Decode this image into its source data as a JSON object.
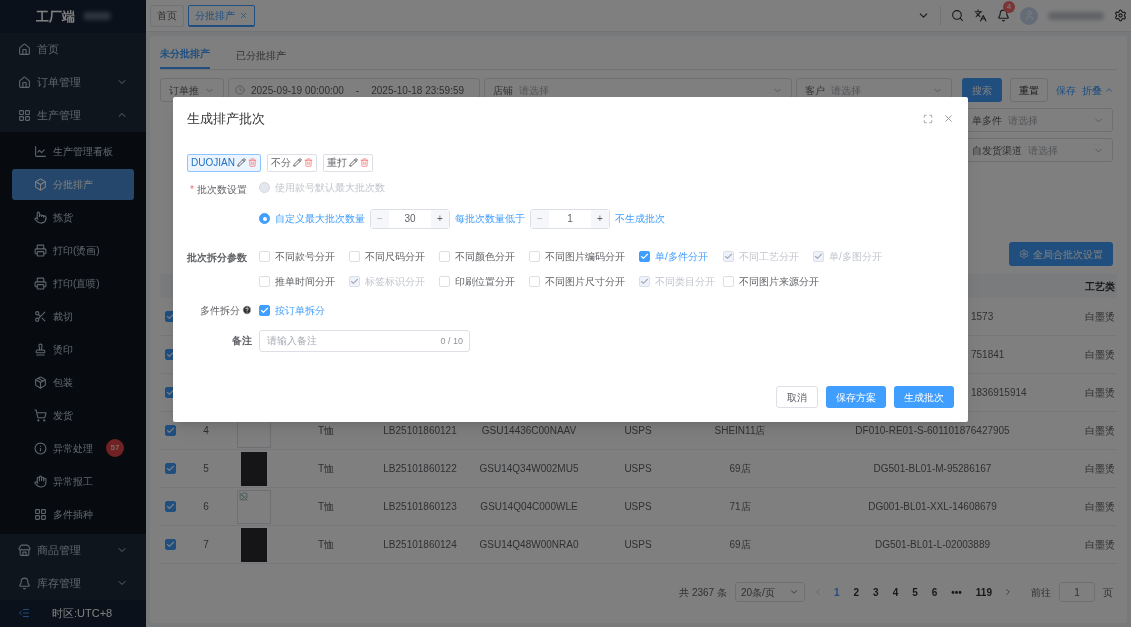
{
  "sidebar": {
    "title": "工厂端",
    "items": [
      {
        "label": "首页",
        "selected": false
      },
      {
        "label": "订单管理",
        "expanded": false,
        "selected": false
      },
      {
        "label": "生产管理",
        "expanded": true,
        "selected": false,
        "children": [
          {
            "label": "生产管理看板",
            "selected": false
          },
          {
            "label": "分批排产",
            "selected": true
          },
          {
            "label": "拣货",
            "selected": false
          },
          {
            "label": "打印(烫画)",
            "selected": false
          },
          {
            "label": "打印(直喷)",
            "selected": false
          },
          {
            "label": "裁切",
            "selected": false
          },
          {
            "label": "烫印",
            "selected": false
          },
          {
            "label": "包装",
            "selected": false
          },
          {
            "label": "发货",
            "selected": false
          },
          {
            "label": "异常处理",
            "selected": false,
            "badge": "57"
          },
          {
            "label": "异常报工",
            "selected": false
          },
          {
            "label": "多件插种",
            "selected": false
          }
        ]
      },
      {
        "label": "商品管理",
        "expanded": false,
        "selected": false
      },
      {
        "label": "库存管理",
        "expanded": false,
        "selected": false
      }
    ],
    "footer": "时区:UTC+8"
  },
  "header": {
    "tabs": [
      {
        "label": "首页",
        "selected": false,
        "closable": false
      },
      {
        "label": "分批排产",
        "selected": true,
        "closable": true
      }
    ],
    "notification_count": "4"
  },
  "page_tabs": [
    {
      "label": "未分批排产",
      "selected": true
    },
    {
      "label": "已分批排产",
      "selected": false
    }
  ],
  "filters": {
    "time_type": "订单推",
    "date_start": "2025-09-19 00:00:00",
    "date_sep": "-",
    "date_end": "2025-10-18 23:59:59",
    "shop": {
      "label": "店铺",
      "placeholder": "请选择"
    },
    "customer": {
      "label": "客户",
      "placeholder": "请选择"
    },
    "search": "搜索",
    "reset": "重置",
    "save": "保存",
    "collapse": "折叠",
    "more": [
      {
        "label": "单多件",
        "placeholder": "请选择"
      },
      {
        "label": "自发货渠道",
        "placeholder": "请选择"
      }
    ]
  },
  "global_merge_button": "全局合批次设置",
  "table": {
    "columns": [
      {
        "label": "工艺类"
      }
    ],
    "rows": [
      {
        "kind": "partial",
        "checked": true,
        "order_no": "1573",
        "craft": "白墨烫"
      },
      {
        "kind": "partial",
        "checked": true,
        "order_no": "751841",
        "craft": "白墨烫"
      },
      {
        "kind": "partial",
        "checked": true,
        "order_no": "1836915914",
        "craft": "白墨烫"
      },
      {
        "kind": "full",
        "checked": true,
        "index": "4",
        "type": "T恤",
        "lb": "LB25101860121",
        "sku": "GSU14436C00NAAV",
        "carrier": "USPS",
        "shop": "SHEIN11店",
        "order_no": "DF010-RE01-S-601101876427905",
        "craft": "白墨烫"
      },
      {
        "kind": "full",
        "checked": true,
        "index": "5",
        "type": "T恤",
        "lb": "LB25101860122",
        "sku": "GSU14Q34W002MU5",
        "carrier": "USPS",
        "shop": "69店",
        "order_no": "DG501-BL01-M-95286167",
        "craft": "白墨烫"
      },
      {
        "kind": "full",
        "checked": true,
        "index": "6",
        "type": "T恤",
        "lb": "LB25101860123",
        "sku": "GSU14Q04C000WLE",
        "carrier": "USPS",
        "shop": "71店",
        "order_no": "DG001-BL01-XXL-14608679",
        "craft": "白墨烫"
      },
      {
        "kind": "full",
        "checked": true,
        "index": "7",
        "type": "T恤",
        "lb": "LB25101860124",
        "sku": "GSU14Q48W00NRA0",
        "carrier": "USPS",
        "shop": "69店",
        "order_no": "DG501-BL01-L-02003889",
        "craft": "白墨烫"
      }
    ]
  },
  "pagination": {
    "total": "共 2367 条",
    "page_size": "20条/页",
    "pages": [
      {
        "label": "1",
        "selected": true
      },
      {
        "label": "2",
        "selected": false
      },
      {
        "label": "3",
        "selected": false
      },
      {
        "label": "4",
        "selected": false
      },
      {
        "label": "5",
        "selected": false
      },
      {
        "label": "6",
        "selected": false
      },
      {
        "label": "•••",
        "selected": false
      },
      {
        "label": "119",
        "selected": false
      }
    ],
    "goto": "前往",
    "goto_value": "1",
    "page_unit": "页"
  },
  "dialog": {
    "title": "生成排产批次",
    "schemes": [
      {
        "label": "DUOJIAN",
        "selected": true
      },
      {
        "label": "不分",
        "selected": false
      },
      {
        "label": "重打",
        "selected": false
      }
    ],
    "batch_label": "批次数设置",
    "required_mark": "*",
    "batch_options": [
      {
        "kind": "default",
        "label": "使用款号默认最大批次数",
        "selected": false,
        "disabled": true
      },
      {
        "kind": "custom",
        "label": "自定义最大批次数量",
        "selected": true,
        "disabled": false,
        "max_stepper": {
          "minus": "−",
          "value": "30",
          "plus": "+"
        },
        "min_label": "每批次数量低于",
        "min_stepper": {
          "minus": "−",
          "value": "1",
          "plus": "+"
        },
        "suffix": "不生成批次"
      }
    ],
    "split_label": "批次拆分参数",
    "split_options": [
      {
        "label": "不同款号分开",
        "checked": false,
        "disabled": false
      },
      {
        "label": "不同尺码分开",
        "checked": false,
        "disabled": false
      },
      {
        "label": "不同颜色分开",
        "checked": false,
        "disabled": false
      },
      {
        "label": "不同图片编码分开",
        "checked": false,
        "disabled": false
      },
      {
        "label": "单/多件分开",
        "checked": true,
        "disabled": false
      },
      {
        "label": "不同工艺分开",
        "checked": true,
        "disabled": true
      },
      {
        "label": "单/多图分开",
        "checked": true,
        "disabled": true
      },
      {
        "label": "推单时间分开",
        "checked": false,
        "disabled": false
      },
      {
        "label": "标签标识分开",
        "checked": true,
        "disabled": true
      },
      {
        "label": "印刷位置分开",
        "checked": false,
        "disabled": false
      },
      {
        "label": "不同图片尺寸分开",
        "checked": false,
        "disabled": false
      },
      {
        "label": "不同类目分开",
        "checked": true,
        "disabled": true
      },
      {
        "label": "不同图片来源分开",
        "checked": false,
        "disabled": false
      }
    ],
    "multi_label": "多件拆分",
    "multi_option": {
      "label": "按订单拆分",
      "checked": true
    },
    "remark_label": "备注",
    "remark_placeholder": "请输入备注",
    "remark_counter": "0 / 10",
    "buttons": [
      {
        "kind": "plain",
        "label": "取消"
      },
      {
        "kind": "primary",
        "label": "保存方案"
      },
      {
        "kind": "primary",
        "label": "生成批次"
      }
    ]
  }
}
